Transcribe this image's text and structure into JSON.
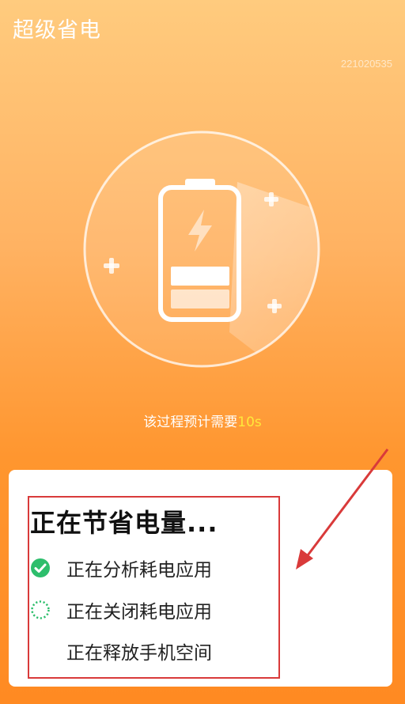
{
  "header": {
    "title": "超级省电",
    "version": "221020535"
  },
  "hero": {
    "icons": {
      "battery": "battery-charging-icon",
      "sparkles": "plus-sparkle-icon"
    },
    "hint_prefix": "该过程预计需要",
    "hint_time": "10s"
  },
  "card": {
    "title": "正在节省电量...",
    "steps": [
      {
        "label": "正在分析耗电应用",
        "status": "done"
      },
      {
        "label": "正在关闭耗电应用",
        "status": "in-progress"
      },
      {
        "label": "正在释放手机空间",
        "status": "pending"
      }
    ]
  },
  "colors": {
    "bg_top": "#FFCB7E",
    "bg_bottom": "#FF8A22",
    "check": "#2DBE6C",
    "spinner": "#2DBE6C",
    "highlight": "#D93A3A",
    "time_accent": "#FFE83A"
  }
}
